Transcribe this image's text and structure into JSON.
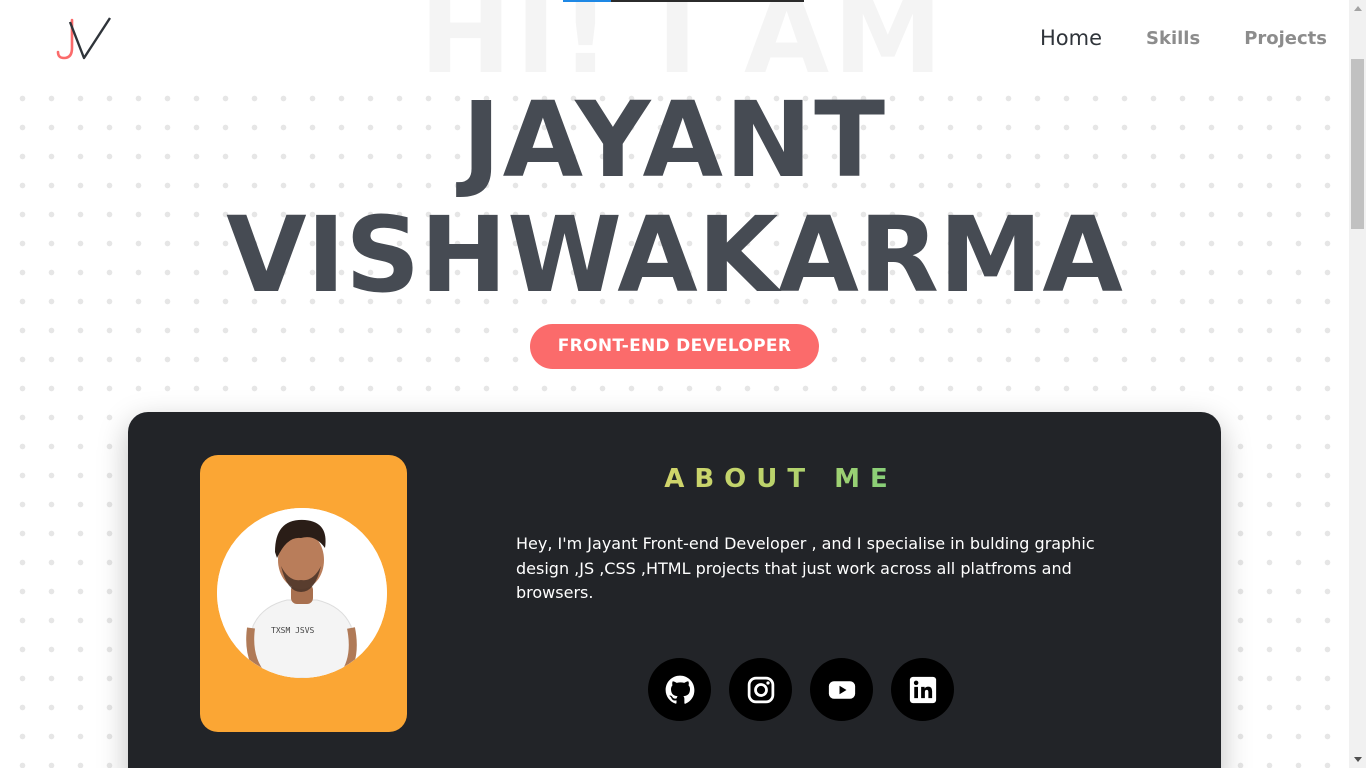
{
  "header": {
    "logo_text": "JV",
    "nav": [
      {
        "label": "Home",
        "active": true
      },
      {
        "label": "Skills",
        "active": false
      },
      {
        "label": "Projects",
        "active": false
      }
    ]
  },
  "page_progress": {
    "fraction": 0.2
  },
  "hero": {
    "background_word": "HI! I AM",
    "first_name": "JAYANT",
    "last_name": "VISHWAKARMA",
    "role": "FRONT-END DEVELOPER"
  },
  "about": {
    "title": "ABOUT ME",
    "text": "Hey, I'm Jayant Front-end Developer , and I specialise in bulding graphic design ,JS ,CSS ,HTML projects that just work across all platfroms and browsers.",
    "photo_shirt_text": "TXSM JSVS",
    "socials": [
      {
        "icon": "github-icon"
      },
      {
        "icon": "instagram-icon"
      },
      {
        "icon": "youtube-icon"
      },
      {
        "icon": "linkedin-icon"
      }
    ]
  },
  "colors": {
    "accent": "#fb6b6b",
    "text_dark": "#464b53",
    "card_bg": "#222428",
    "photo_bg": "#fba634",
    "title_gradient": [
      "#f0d56a",
      "#3ec98b"
    ]
  }
}
